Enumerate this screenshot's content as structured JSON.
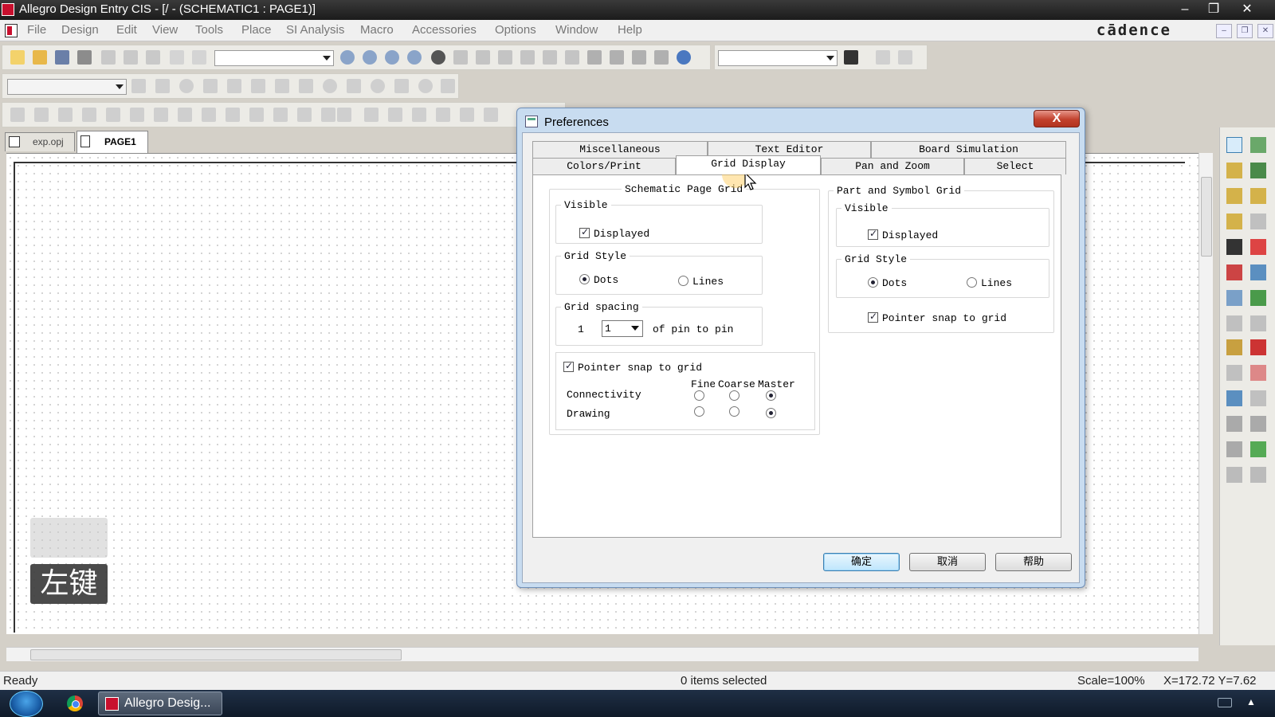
{
  "window": {
    "title": "Allegro Design Entry CIS - [/ - (SCHEMATIC1 : PAGE1)]",
    "brand": "cādence"
  },
  "menu": [
    "File",
    "Design",
    "Edit",
    "View",
    "Tools",
    "Place",
    "SI Analysis",
    "Macro",
    "Accessories",
    "Options",
    "Window",
    "Help"
  ],
  "doc_tabs": [
    "exp.opj",
    "PAGE1"
  ],
  "dialog": {
    "title": "Preferences",
    "close_label": "X",
    "tabs_row1": [
      "Miscellaneous",
      "Text Editor",
      "Board Simulation"
    ],
    "tabs_row2": [
      "Colors/Print",
      "Grid Display",
      "Pan and Zoom",
      "Select"
    ],
    "active_tab": "Grid Display",
    "schematic": {
      "title": "Schematic Page Grid",
      "visible_label": "Visible",
      "displayed_label": "Displayed",
      "displayed": true,
      "grid_style_label": "Grid Style",
      "dots_label": "Dots",
      "lines_label": "Lines",
      "style": "Dots",
      "spacing_label": "Grid spacing",
      "spacing_value": "1",
      "spacing_select": "1",
      "spacing_suffix": "of pin to pin",
      "snap_label": "Pointer snap to grid",
      "snap": true,
      "col_fine": "Fine",
      "col_coarse": "Coarse",
      "col_master": "Master",
      "row_connectivity": "Connectivity",
      "row_drawing": "Drawing",
      "connectivity_selected": "Master",
      "drawing_selected": "Master"
    },
    "part": {
      "title": "Part and Symbol Grid",
      "visible_label": "Visible",
      "displayed_label": "Displayed",
      "displayed": true,
      "grid_style_label": "Grid Style",
      "dots_label": "Dots",
      "lines_label": "Lines",
      "style": "Dots",
      "snap_label": "Pointer snap to grid",
      "snap": true
    },
    "buttons": {
      "ok": "确定",
      "cancel": "取消",
      "help": "帮助"
    }
  },
  "overlay": {
    "key_label": "左键"
  },
  "status": {
    "ready": "Ready",
    "selection": "0 items selected",
    "scale": "Scale=100%",
    "coords": "X=172.72  Y=7.62"
  },
  "taskbar": {
    "task_label": "Allegro Desig..."
  },
  "colors": {
    "accent": "#3c7fb1",
    "titlebar": "#1b1b1b",
    "close_red": "#c2412d",
    "canvas_dot": "#c9c9c9"
  }
}
